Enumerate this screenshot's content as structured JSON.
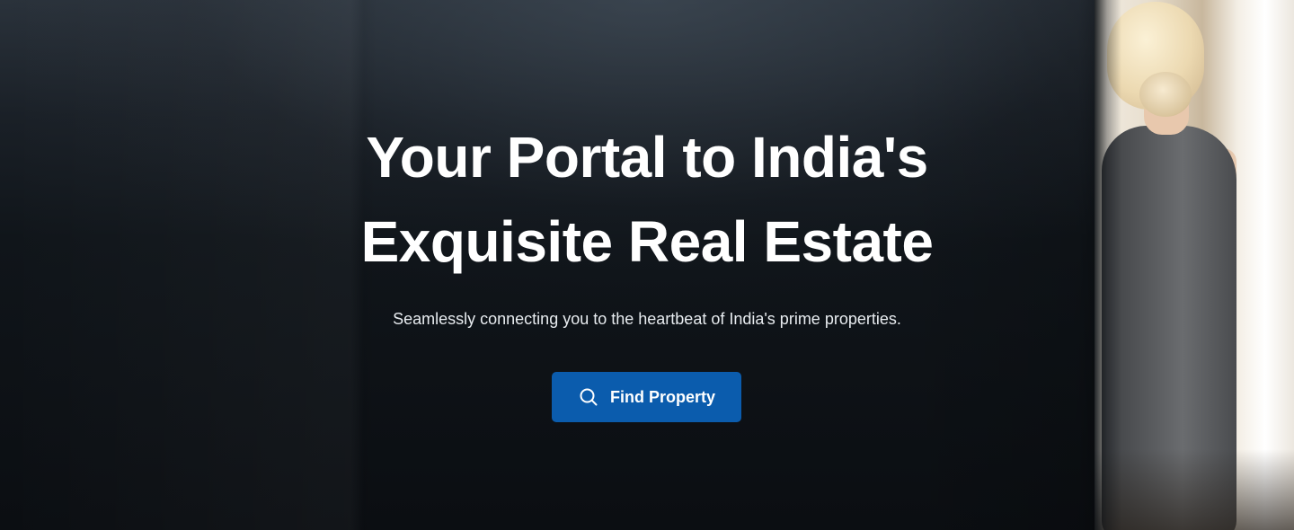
{
  "hero": {
    "title_line1": "Your Portal to India's",
    "title_line2": "Exquisite Real Estate",
    "subtitle": "Seamlessly connecting you to the heartbeat of India's prime properties.",
    "cta": {
      "label": "Find Property",
      "icon": "search-icon",
      "color": "#0b5cad"
    }
  },
  "colors": {
    "background": "#10151a",
    "text": "#ffffff",
    "accent": "#0b5cad"
  }
}
